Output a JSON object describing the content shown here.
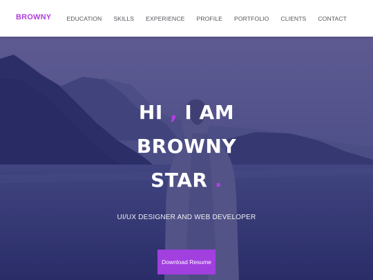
{
  "brand": "BROWNY",
  "nav": [
    "EDUCATION",
    "SKILLS",
    "EXPERIENCE",
    "PROFILE",
    "PORTFOLIO",
    "CLIENTS",
    "CONTACT"
  ],
  "hero": {
    "line1_a": "HI ",
    "line1_comma": ",",
    "line1_b": " I AM",
    "line2": "BROWNY",
    "line3": "STAR ",
    "line3_dot": ".",
    "subtitle": "UI/UX DESIGNER AND WEB DEVELOPER",
    "button": "Download Resume"
  },
  "colors": {
    "accent": "#b03fe0",
    "button": "#a23fdf",
    "overlay": "#28226e",
    "header_bg": "#ffffff",
    "nav_text": "#55565c"
  }
}
